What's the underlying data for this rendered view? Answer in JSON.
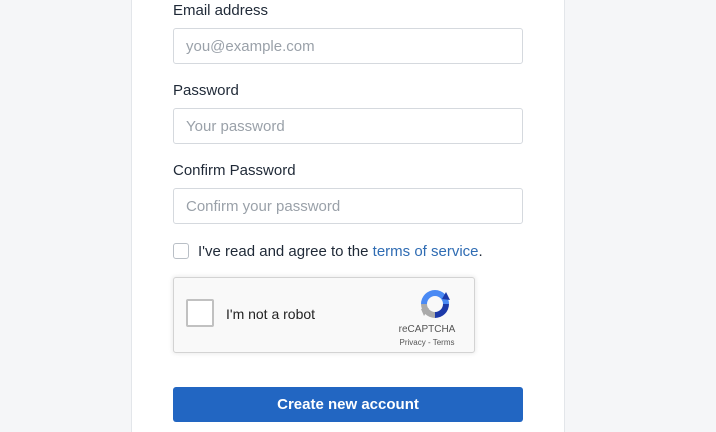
{
  "form": {
    "email": {
      "label": "Email address",
      "placeholder": "you@example.com",
      "value": ""
    },
    "password": {
      "label": "Password",
      "placeholder": "Your password",
      "value": ""
    },
    "confirm_password": {
      "label": "Confirm Password",
      "placeholder": "Confirm your password",
      "value": ""
    },
    "terms": {
      "prefix": "I've read and agree to the ",
      "link_text": "terms of service",
      "suffix": ".",
      "checked": false
    },
    "recaptcha": {
      "label": "I'm not a robot",
      "brand": "reCAPTCHA",
      "privacy_link": "Privacy",
      "separator": " - ",
      "terms_link": "Terms",
      "icon": "recaptcha-logo-icon"
    },
    "submit_label": "Create new account"
  },
  "colors": {
    "primary": "#2266c2",
    "link": "#2f6cb3",
    "text": "#1f2937",
    "placeholder": "#9aa1a9",
    "page_background": "#f5f6f8",
    "card_background": "#ffffff"
  }
}
